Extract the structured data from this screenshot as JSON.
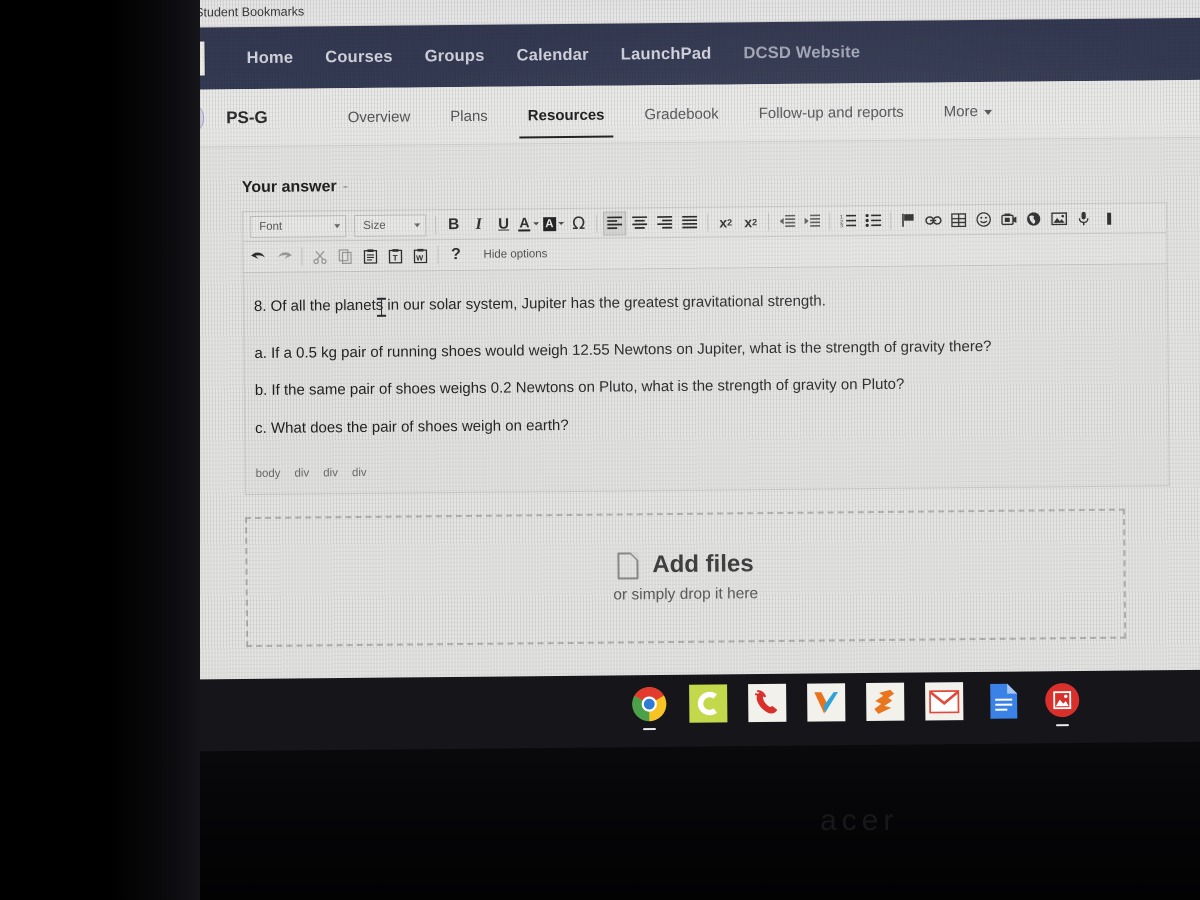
{
  "browser": {
    "bookmarks": [
      {
        "icon": "folder-icon",
        "label": "Student Bookmarks"
      }
    ]
  },
  "topnav": {
    "brand_logo": "v-checkmark-logo",
    "items": [
      {
        "label": "Home"
      },
      {
        "label": "Courses"
      },
      {
        "label": "Groups"
      },
      {
        "label": "Calendar"
      },
      {
        "label": "LaunchPad"
      },
      {
        "label": "DCSD Website"
      }
    ]
  },
  "coursenav": {
    "avatar_icon": "graduation-cap-icon",
    "course_title": "PS-G",
    "items": [
      {
        "label": "Overview",
        "active": false
      },
      {
        "label": "Plans",
        "active": false
      },
      {
        "label": "Resources",
        "active": true
      },
      {
        "label": "Gradebook",
        "active": false
      },
      {
        "label": "Follow-up and reports",
        "active": false
      },
      {
        "label": "More",
        "active": false,
        "has_caret": true
      }
    ]
  },
  "editor": {
    "section_title": "Your answer",
    "section_title_suffix": "-",
    "toolbar": {
      "font_label": "Font",
      "size_label": "Size",
      "bold_label": "B",
      "italic_label": "I",
      "underline_label": "U",
      "font_color_label": "A",
      "highlight_color_label": "A",
      "special_char_label": "Ω",
      "align_left": "align-left-icon",
      "align_center": "align-center-icon",
      "align_right": "align-right-icon",
      "align_justify": "align-justify-icon",
      "subscript_label": "x",
      "subscript_sub": "2",
      "superscript_label": "x",
      "superscript_sup": "2",
      "outdent": "outdent-icon",
      "indent": "indent-icon",
      "numbered_list": "numbered-list-icon",
      "bulleted_list": "bulleted-list-icon",
      "flag": "flag-icon",
      "link": "link-icon",
      "table": "table-icon",
      "emoji": "smiley-icon",
      "video": "video-camera-icon",
      "globe": "globe-icon",
      "image": "image-icon",
      "microphone": "microphone-icon",
      "undo": "undo-arrow-icon",
      "redo": "redo-arrow-icon",
      "cut": "scissors-icon",
      "copy": "copy-icon",
      "paste": "paste-icon",
      "paste_as_text": "paste-as-text-icon",
      "paste_from_word": "paste-from-word-icon",
      "help_label": "?",
      "hide_options_label": "Hide options"
    },
    "body": {
      "question": "8. Of all the planets in our solar system, Jupiter has the greatest gravitational strength.",
      "part_a": "a. If a 0.5 kg pair of running shoes would weigh 12.55 Newtons on Jupiter, what is the strength of gravity there?",
      "part_b": "b. If the same pair of shoes weighs 0.2 Newtons on Pluto, what is the strength of gravity on Pluto?",
      "part_c": "c. What does the pair of shoes weigh on earth?"
    },
    "element_path": [
      "body",
      "div",
      "div",
      "div"
    ]
  },
  "dropzone": {
    "icon": "file-page-icon",
    "title": "Add files",
    "subtitle": "or simply drop it here"
  },
  "shelf": {
    "launcher_icon": "launcher-circle-icon",
    "apps": [
      {
        "name": "chrome-icon",
        "running": true
      },
      {
        "name": "clever-icon",
        "running": false
      },
      {
        "name": "phone-call-icon",
        "running": false
      },
      {
        "name": "v-checkmark-icon",
        "running": false
      },
      {
        "name": "kangaroo-icon",
        "running": false
      },
      {
        "name": "gmail-icon",
        "running": false
      },
      {
        "name": "google-docs-icon",
        "running": false
      },
      {
        "name": "photos-app-icon",
        "running": true
      }
    ]
  },
  "device": {
    "brand_text": "acer"
  },
  "colors": {
    "topnav_bg": "#353b54",
    "page_bg": "#e4e4e2",
    "shelf_bg": "#15151a",
    "accent_text": "#1f1f1f"
  }
}
